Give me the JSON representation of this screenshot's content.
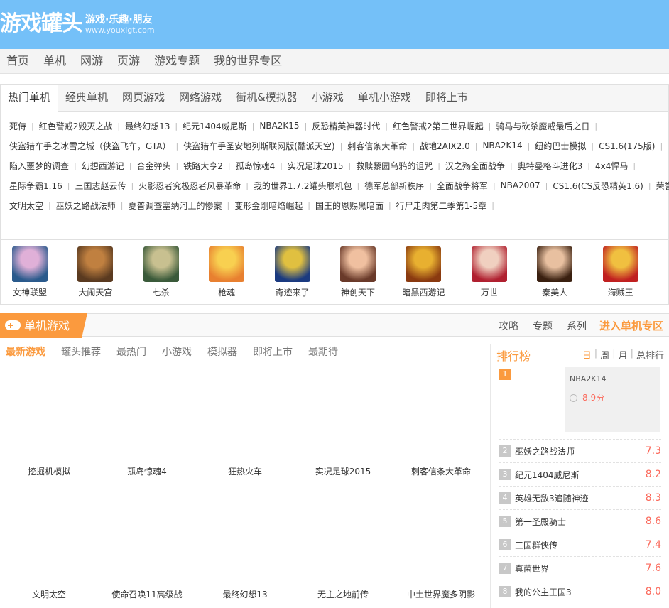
{
  "header": {
    "logo": "游戏罐头",
    "slogan": "游戏·乐趣·朋友",
    "url": "www.youxigt.com"
  },
  "nav": [
    "首页",
    "单机",
    "网游",
    "页游",
    "游戏专题",
    "我的世界专区"
  ],
  "hot": {
    "tabs": [
      "热门单机",
      "经典单机",
      "网页游戏",
      "网络游戏",
      "街机&模拟器",
      "小游戏",
      "单机小游戏",
      "即将上市"
    ],
    "rows": [
      [
        "死侍",
        "红色警戒2毁灭之战",
        "最终幻想13",
        "纪元1404威尼斯",
        "NBA2K15",
        "反恐精英神器时代",
        "红色警戒2第三世界崛起",
        "骑马与砍杀魔戒最后之日"
      ],
      [
        "侠盗猎车手之冰雪之城（侠盗飞车，GTA）",
        "侠盗猎车手圣安地列斯联网版(酷派天空)",
        "刺客信条大革命",
        "战地2AIX2.0",
        "NBA2K14",
        "纽约巴士模拟",
        "CS1.6(175版)"
      ],
      [
        "陷入噩梦的调查",
        "幻想西游记",
        "合金弹头",
        "铁路大亨2",
        "孤岛惊魂4",
        "实况足球2015",
        "救赎藜园乌鸦的诅咒",
        "汉之殇全面战争",
        "奥特曼格斗进化3",
        "4x4悍马"
      ],
      [
        "星际争霸1.16",
        "三国志赵云传",
        "火影忍者究极忍者风暴革命",
        "我的世界1.7.2罐头联机包",
        "德军总部新秩序",
        "全面战争将军",
        "NBA2007",
        "CS1.6(CS反恐精英1.6)",
        "荣誉骑士"
      ],
      [
        "文明太空",
        "巫妖之路战法师",
        "夏普调查塞纳河上的惨案",
        "变形金刚暗焰崛起",
        "国王的恩赐黑暗面",
        "行尸走肉第二季第1-5章"
      ]
    ]
  },
  "avatars": [
    {
      "name": "女神联盟",
      "c1": "#2a5a8c",
      "c2": "#e0b0d8"
    },
    {
      "name": "大闹天宫",
      "c1": "#5a3a20",
      "c2": "#c08040"
    },
    {
      "name": "七杀",
      "c1": "#3a5a3a",
      "c2": "#c8c090"
    },
    {
      "name": "枪魂",
      "c1": "#e88030",
      "c2": "#f8d050"
    },
    {
      "name": "奇迹来了",
      "c1": "#1a3a80",
      "c2": "#e0c040"
    },
    {
      "name": "神创天下",
      "c1": "#6a3a2a",
      "c2": "#f0c0a0"
    },
    {
      "name": "暗黑西游记",
      "c1": "#8a3a10",
      "c2": "#e8b030"
    },
    {
      "name": "万世",
      "c1": "#b02030",
      "c2": "#f0d0c0"
    },
    {
      "name": "秦美人",
      "c1": "#3a2010",
      "c2": "#e8c0a0"
    },
    {
      "name": "海贼王",
      "c1": "#c02020",
      "c2": "#f0c040"
    }
  ],
  "single": {
    "title": "单机游戏",
    "links": [
      "攻略",
      "专题",
      "系列"
    ],
    "enter": "进入单机专区",
    "tabs": [
      "最新游戏",
      "罐头推荐",
      "最热门",
      "小游戏",
      "模拟器",
      "即将上市",
      "最期待"
    ],
    "row1": [
      "挖掘机模拟",
      "孤岛惊魂4",
      "狂热火车",
      "实况足球2015",
      "刺客信条大革命"
    ],
    "row2": [
      "文明太空",
      "使命召唤11高级战",
      "最终幻想13",
      "无主之地前传",
      "中土世界魔多阴影"
    ]
  },
  "rank": {
    "title": "排行榜",
    "periods": [
      "日",
      "周",
      "月",
      "总排行"
    ],
    "first": {
      "no": "1",
      "name": "NBA2K14",
      "score": "8.9",
      "unit": "分"
    },
    "items": [
      {
        "no": "2",
        "name": "巫妖之路战法师",
        "score": "7.3"
      },
      {
        "no": "3",
        "name": "纪元1404威尼斯",
        "score": "8.2"
      },
      {
        "no": "4",
        "name": "英雄无敌3追随神迹",
        "score": "8.3"
      },
      {
        "no": "5",
        "name": "第一圣殿骑士",
        "score": "8.6"
      },
      {
        "no": "6",
        "name": "三国群侠传",
        "score": "7.4"
      },
      {
        "no": "7",
        "name": "真菌世界",
        "score": "7.6"
      },
      {
        "no": "8",
        "name": "我的公主王国3",
        "score": "8.0"
      }
    ]
  }
}
